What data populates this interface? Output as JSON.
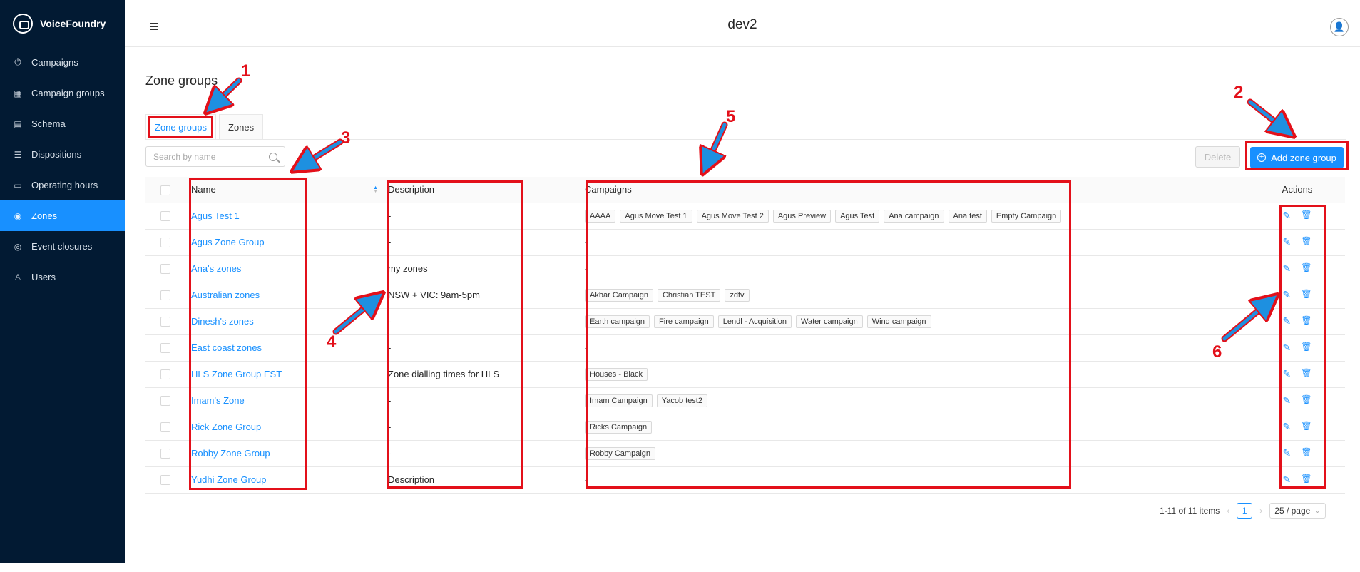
{
  "app": {
    "name": "VoiceFoundry",
    "header_title": "dev2"
  },
  "sidebar": {
    "items": [
      {
        "label": "Campaigns",
        "icon": "power-icon",
        "active": false
      },
      {
        "label": "Campaign groups",
        "icon": "campaign-groups-icon",
        "active": false
      },
      {
        "label": "Schema",
        "icon": "schema-icon",
        "active": false
      },
      {
        "label": "Dispositions",
        "icon": "list-icon",
        "active": false
      },
      {
        "label": "Operating hours",
        "icon": "calendar-icon",
        "active": false
      },
      {
        "label": "Zones",
        "icon": "location-icon",
        "active": true
      },
      {
        "label": "Event closures",
        "icon": "target-icon",
        "active": false
      },
      {
        "label": "Users",
        "icon": "user-icon",
        "active": false
      }
    ]
  },
  "page": {
    "title": "Zone groups",
    "tabs": [
      {
        "label": "Zone groups",
        "active": true
      },
      {
        "label": "Zones",
        "active": false
      }
    ],
    "search_placeholder": "Search by name",
    "delete_label": "Delete",
    "add_label": "Add zone group"
  },
  "table": {
    "headers": {
      "name": "Name",
      "description": "Description",
      "campaigns": "Campaigns",
      "actions": "Actions"
    },
    "rows": [
      {
        "name": "Agus Test 1",
        "description": "-",
        "campaigns": [
          "AAAA",
          "Agus Move Test 1",
          "Agus Move Test 2",
          "Agus Preview",
          "Agus Test",
          "Ana campaign",
          "Ana test",
          "Empty Campaign"
        ]
      },
      {
        "name": "Agus Zone Group",
        "description": "-",
        "campaigns": []
      },
      {
        "name": "Ana's zones",
        "description": "my zones",
        "campaigns": []
      },
      {
        "name": "Australian zones",
        "description": "NSW + VIC: 9am-5pm",
        "campaigns": [
          "Akbar Campaign",
          "Christian TEST",
          "zdfv"
        ]
      },
      {
        "name": "Dinesh's zones",
        "description": "-",
        "campaigns": [
          "Earth campaign",
          "Fire campaign",
          "Lendl - Acquisition",
          "Water campaign",
          "Wind campaign"
        ]
      },
      {
        "name": "East coast zones",
        "description": "-",
        "campaigns": []
      },
      {
        "name": "HLS Zone Group EST",
        "description": "Zone dialling times for HLS",
        "campaigns": [
          "Houses - Black"
        ]
      },
      {
        "name": "Imam's Zone",
        "description": "-",
        "campaigns": [
          "Imam Campaign",
          "Yacob test2"
        ]
      },
      {
        "name": "Rick Zone Group",
        "description": "-",
        "campaigns": [
          "Ricks Campaign"
        ]
      },
      {
        "name": "Robby Zone Group",
        "description": "-",
        "campaigns": [
          "Robby Campaign"
        ]
      },
      {
        "name": "Yudhi Zone Group",
        "description": "Description",
        "campaigns": []
      }
    ],
    "empty_campaigns": "-"
  },
  "pagination": {
    "summary": "1-11 of 11 items",
    "current_page": "1",
    "page_size": "25 / page"
  },
  "annotations": {
    "labels": [
      "1",
      "2",
      "3",
      "4",
      "5",
      "6"
    ],
    "color": "#e3101a"
  },
  "colors": {
    "sidebar_bg": "#021a33",
    "accent": "#1890ff"
  }
}
